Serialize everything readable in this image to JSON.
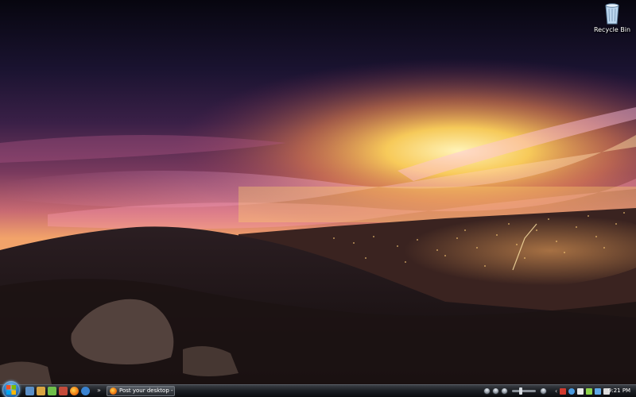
{
  "desktop": {
    "icons": [
      {
        "label": "Recycle Bin",
        "icon": "recycle-bin-icon"
      }
    ]
  },
  "taskbar": {
    "start_button_icon": "windows-logo-icon",
    "quick_launch": [
      {
        "icon": "show-desktop-icon",
        "color": "#5b8fc7"
      },
      {
        "icon": "switch-windows-icon",
        "color": "#d9a441"
      },
      {
        "icon": "app-icon",
        "color": "#6fbf4a"
      },
      {
        "icon": "app-icon",
        "color": "#c44b3a"
      },
      {
        "icon": "firefox-icon",
        "color": "#f07a12"
      },
      {
        "icon": "app-icon",
        "color": "#3a83d1"
      }
    ],
    "quick_launch_more": "»",
    "task_buttons": [
      {
        "label": "Post your desktop - ...",
        "icon": "firefox-icon"
      }
    ],
    "media_controls": {
      "buttons": [
        "stop-icon",
        "pause-icon",
        "previous-icon",
        "next-icon"
      ],
      "volume_level": 0.35
    },
    "tray": {
      "expand": "‹",
      "icons": [
        {
          "icon": "antivirus-icon",
          "color": "#d23b2e"
        },
        {
          "icon": "messenger-icon",
          "color": "#4a9be0"
        },
        {
          "icon": "mail-icon",
          "color": "#e8e8e8"
        },
        {
          "icon": "update-icon",
          "color": "#8fd44a"
        },
        {
          "icon": "network-icon",
          "color": "#5fa8e6"
        },
        {
          "icon": "volume-icon",
          "color": "#dcdcdc"
        }
      ]
    },
    "clock": "9:21 PM"
  }
}
